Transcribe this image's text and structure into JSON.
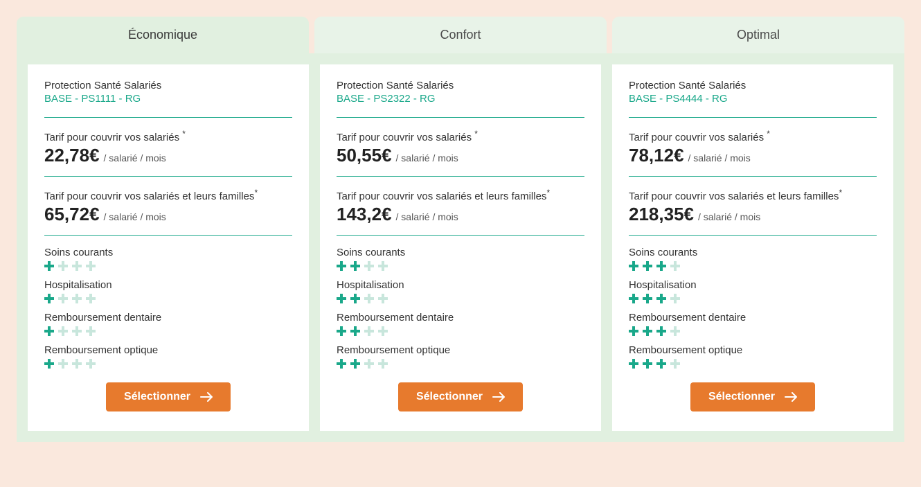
{
  "tabs": [
    {
      "label": "Économique"
    },
    {
      "label": "Confort"
    },
    {
      "label": "Optimal"
    }
  ],
  "common": {
    "product_title": "Protection Santé Salariés",
    "price_label_employees": "Tarif pour couvrir vos salariés ",
    "price_label_family": "Tarif pour couvrir vos salariés et leurs familles",
    "price_suffix": "/ salarié / mois",
    "asterisk": "*",
    "features": [
      "Soins courants",
      "Hospitalisation",
      "Remboursement dentaire",
      "Remboursement optique"
    ],
    "select_label": "Sélectionner"
  },
  "plans": [
    {
      "code": "BASE - PS1111 - RG",
      "price_employees": "22,78€",
      "price_family": "65,72€",
      "ratings": [
        1,
        1,
        1,
        1
      ]
    },
    {
      "code": "BASE - PS2322 - RG",
      "price_employees": "50,55€",
      "price_family": "143,2€",
      "ratings": [
        2,
        2,
        2,
        2
      ]
    },
    {
      "code": "BASE - PS4444 - RG",
      "price_employees": "78,12€",
      "price_family": "218,35€",
      "ratings": [
        3,
        3,
        3,
        3
      ]
    }
  ]
}
